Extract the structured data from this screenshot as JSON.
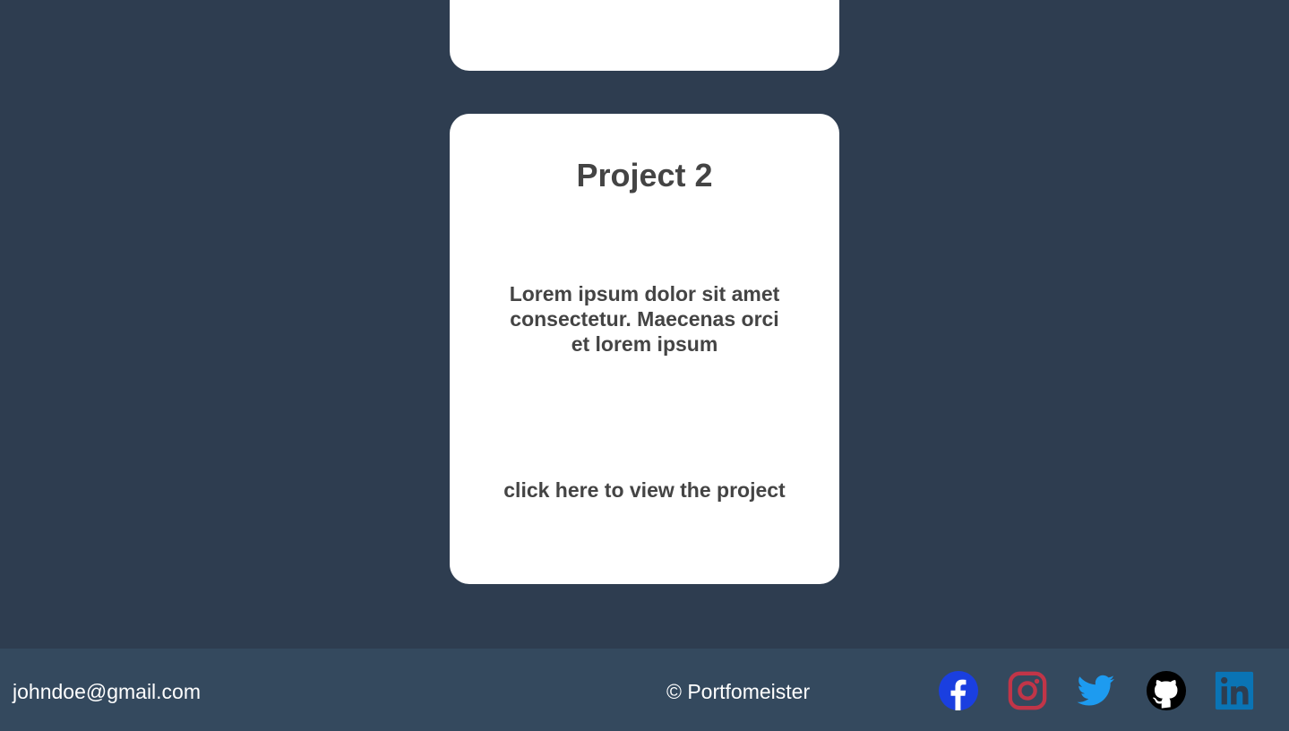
{
  "projects": {
    "card2": {
      "title": "Project 2",
      "description": "Lorem ipsum dolor sit amet consectetur. Maecenas orci et lorem ipsum",
      "link_label": "click here to view the project"
    }
  },
  "footer": {
    "email": "johndoe@gmail.com",
    "copyright": "© Portfomeister",
    "social": [
      {
        "icon": "facebook-icon",
        "color": "#1a3fe0"
      },
      {
        "icon": "instagram-icon",
        "color": "#c13548"
      },
      {
        "icon": "twitter-icon",
        "color": "#1d9bf0"
      },
      {
        "icon": "github-icon",
        "color": "#000000"
      },
      {
        "icon": "linkedin-icon",
        "color": "#0a74b5"
      }
    ]
  },
  "colors": {
    "background": "#2e3d50",
    "footer_background": "#34495e",
    "card_background": "#ffffff",
    "card_text": "#444444"
  }
}
